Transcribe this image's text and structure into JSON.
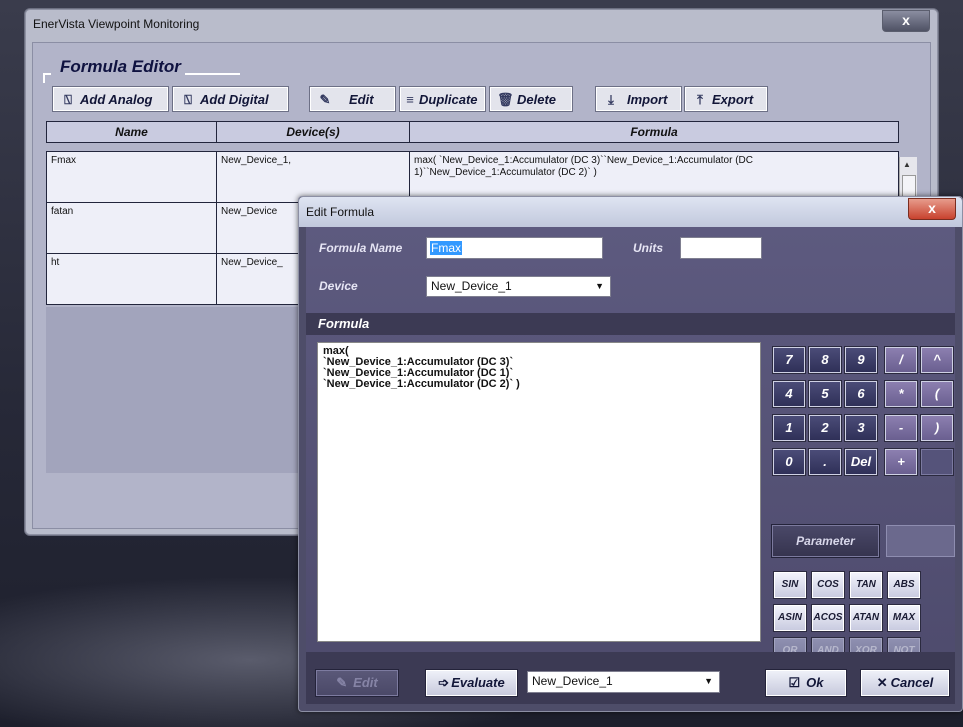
{
  "main_window": {
    "title": "EnerVista Viewpoint Monitoring",
    "close": "x",
    "section_title": "Formula Editor",
    "toolbar": {
      "add_analog": "Add Analog",
      "add_digital": "Add Digital",
      "edit": "Edit",
      "duplicate": "Duplicate",
      "delete": "Delete",
      "import": "Import",
      "export": "Export"
    },
    "table": {
      "headers": [
        "Name",
        "Device(s)",
        "Formula"
      ],
      "rows": [
        {
          "name": "Fmax",
          "devices": "New_Device_1,",
          "formula": "max( `New_Device_1:Accumulator (DC 3)``New_Device_1:Accumulator (DC 1)``New_Device_1:Accumulator (DC 2)` )"
        },
        {
          "name": "fatan",
          "devices": "New_Device",
          "formula": ""
        },
        {
          "name": "ht",
          "devices": "New_Device_",
          "formula": ""
        }
      ]
    }
  },
  "dialog": {
    "title": "Edit Formula",
    "close": "x",
    "formula_name_label": "Formula Name",
    "formula_name_value": "Fmax",
    "units_label": "Units",
    "units_value": "",
    "device_label": "Device",
    "device_value": "New_Device_1",
    "formula_header": "Formula",
    "formula_lines": [
      "max(",
      "`New_Device_1:Accumulator (DC 3)`",
      "`New_Device_1:Accumulator (DC 1)`",
      "`New_Device_1:Accumulator (DC 2)` )"
    ],
    "keypad": {
      "k7": "7",
      "k8": "8",
      "k9": "9",
      "kdiv": "/",
      "kpow": "^",
      "k4": "4",
      "k5": "5",
      "k6": "6",
      "kmul": "*",
      "klp": "(",
      "k1": "1",
      "k2": "2",
      "k3": "3",
      "ksub": "-",
      "krp": ")",
      "k0": "0",
      "kdot": ".",
      "kdel": "Del",
      "kadd": "+"
    },
    "parameter": "Parameter",
    "functions": {
      "sin": "SIN",
      "cos": "COS",
      "tan": "TAN",
      "abs": "ABS",
      "asin": "ASIN",
      "acos": "ACOS",
      "atan": "ATAN",
      "max": "MAX",
      "or": "OR",
      "and": "AND",
      "xor": "XOR",
      "not": "NOT"
    },
    "bottom": {
      "edit": "Edit",
      "evaluate": "Evaluate",
      "device_value": "New_Device_1",
      "ok": "Ok",
      "cancel": "Cancel"
    }
  }
}
